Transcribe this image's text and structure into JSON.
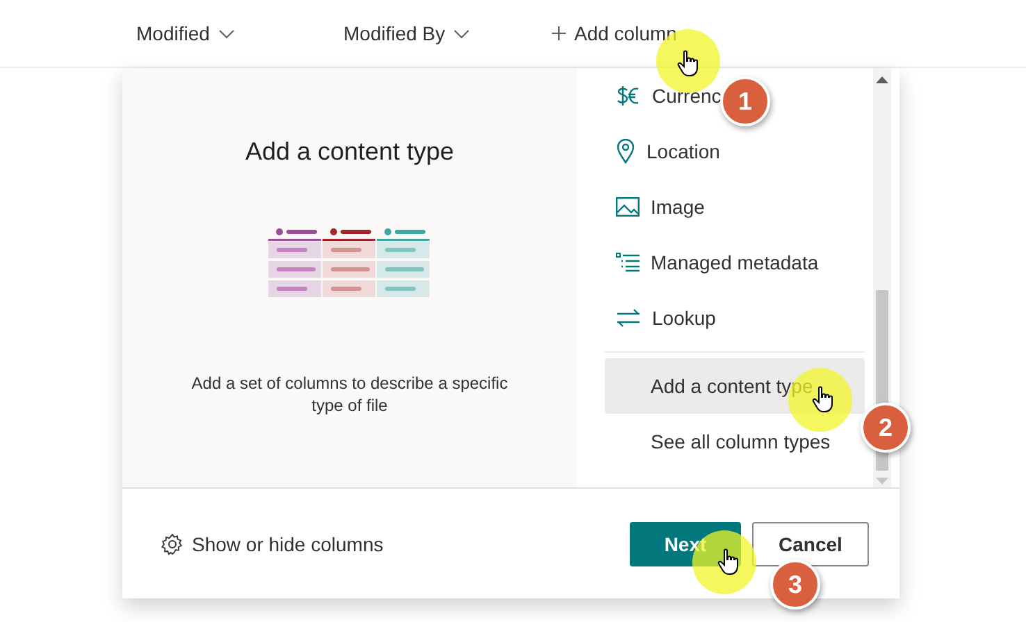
{
  "header": {
    "columns": [
      {
        "label": "Modified",
        "kind": "sortable"
      },
      {
        "label": "Modified By",
        "kind": "sortable"
      },
      {
        "label": "Add column",
        "kind": "add"
      }
    ]
  },
  "dialog": {
    "title": "Add a content type",
    "description": "Add a set of columns to describe a specific type of file",
    "items": [
      {
        "label": "Currenc",
        "kind": "currency",
        "selected": false
      },
      {
        "label": "Location",
        "kind": "location",
        "selected": false
      },
      {
        "label": "Image",
        "kind": "image",
        "selected": false
      },
      {
        "label": "Managed metadata",
        "kind": "metadata",
        "selected": false
      },
      {
        "label": "Lookup",
        "kind": "lookup",
        "selected": false
      },
      {
        "label": "Add a content type",
        "kind": "plain",
        "selected": true
      },
      {
        "label": "See all column types",
        "kind": "plain",
        "selected": false
      }
    ],
    "footer": {
      "link": "Show or hide columns",
      "primary": "Next",
      "secondary": "Cancel"
    }
  },
  "annotations": [
    {
      "number": "1"
    },
    {
      "number": "2"
    },
    {
      "number": "3"
    }
  ]
}
